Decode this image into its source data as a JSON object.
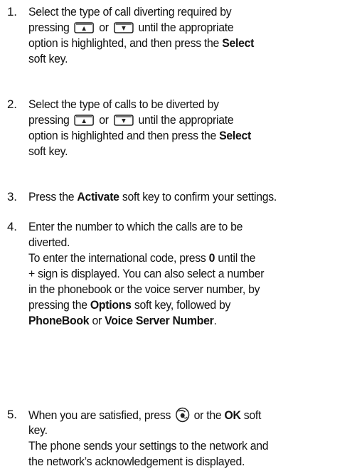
{
  "steps": [
    {
      "number": "1.",
      "t1": "Select the type of call diverting required by",
      "t2a": "pressing",
      "t2b": "or",
      "t2c": "until the appropriate",
      "t3a": "option is highlighted, and then press the",
      "t3b": "Select",
      "t4": "soft key."
    },
    {
      "number": "2.",
      "t1": "Select the type of calls to be diverted by",
      "t2a": "pressing",
      "t2b": "or",
      "t2c": "until the appropriate",
      "t3a": "option is highlighted and then press the",
      "t3b": "Select",
      "t4": "soft key."
    },
    {
      "number": "3.",
      "t1a": "Press the",
      "t1b": "Activate",
      "t1c": "soft key to confirm your settings."
    },
    {
      "number": "4.",
      "t1": "Enter the number to which the calls are to be",
      "t2": "diverted.",
      "t3a": "To enter the international code, press",
      "t3b": "0",
      "t3c": "until the",
      "t4": "+ sign is displayed. You can also select a number",
      "t5": "in the phonebook or the voice server number, by",
      "t6a": "pressing the",
      "t6b": "Options",
      "t6c": "soft key, followed by",
      "t7a": "PhoneBook",
      "t7b": "or",
      "t7c": "Voice Server Number",
      "t7d": "."
    },
    {
      "number": "5.",
      "t1a": "When you are satisfied, press",
      "t1b": "or the",
      "t1c": "OK",
      "t1d": "soft",
      "t2": "key.",
      "t3": "The phone sends your settings to the network and",
      "t4": "the network’s acknowledgement is displayed."
    }
  ],
  "icons": {
    "up": "navigation-up-key-icon",
    "down": "navigation-down-key-icon",
    "ok": "ok-key-icon"
  }
}
